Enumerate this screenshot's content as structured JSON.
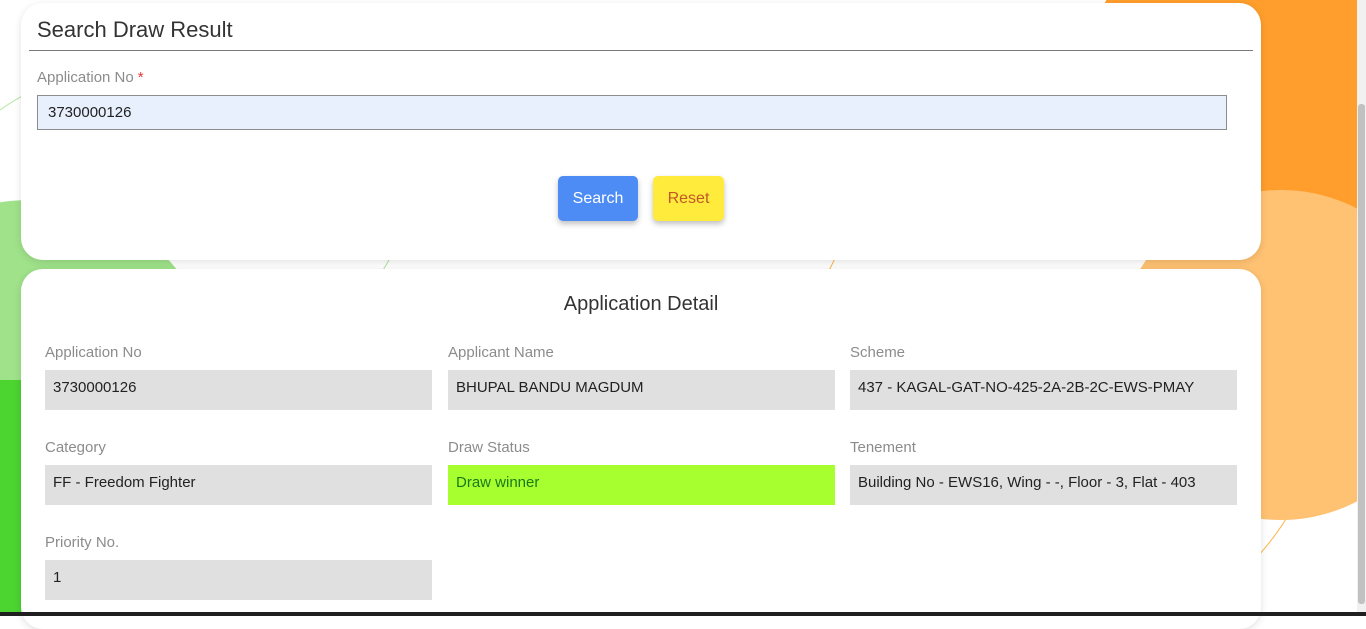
{
  "search": {
    "title": "Search Draw Result",
    "field_label": "Application No",
    "required_mark": "*",
    "input_value": "3730000126",
    "search_button": "Search",
    "reset_button": "Reset"
  },
  "detail": {
    "title": "Application Detail",
    "fields": [
      {
        "label": "Application No",
        "value": "3730000126"
      },
      {
        "label": "Applicant Name",
        "value": "BHUPAL BANDU MAGDUM"
      },
      {
        "label": "Scheme",
        "value": "437 - KAGAL-GAT-NO-425-2A-2B-2C-EWS-PMAY"
      },
      {
        "label": "Category",
        "value": "FF - Freedom Fighter"
      },
      {
        "label": "Draw Status",
        "value": "Draw winner"
      },
      {
        "label": "Tenement",
        "value": "Building No - EWS16, Wing - -, Floor - 3, Flat - 403"
      },
      {
        "label": "Priority No.",
        "value": "1"
      }
    ]
  },
  "colors": {
    "primary_button": "#4d8cf5",
    "reset_button": "#ffeb3b",
    "winner_highlight": "#a8ff30",
    "required": "#e53935"
  }
}
